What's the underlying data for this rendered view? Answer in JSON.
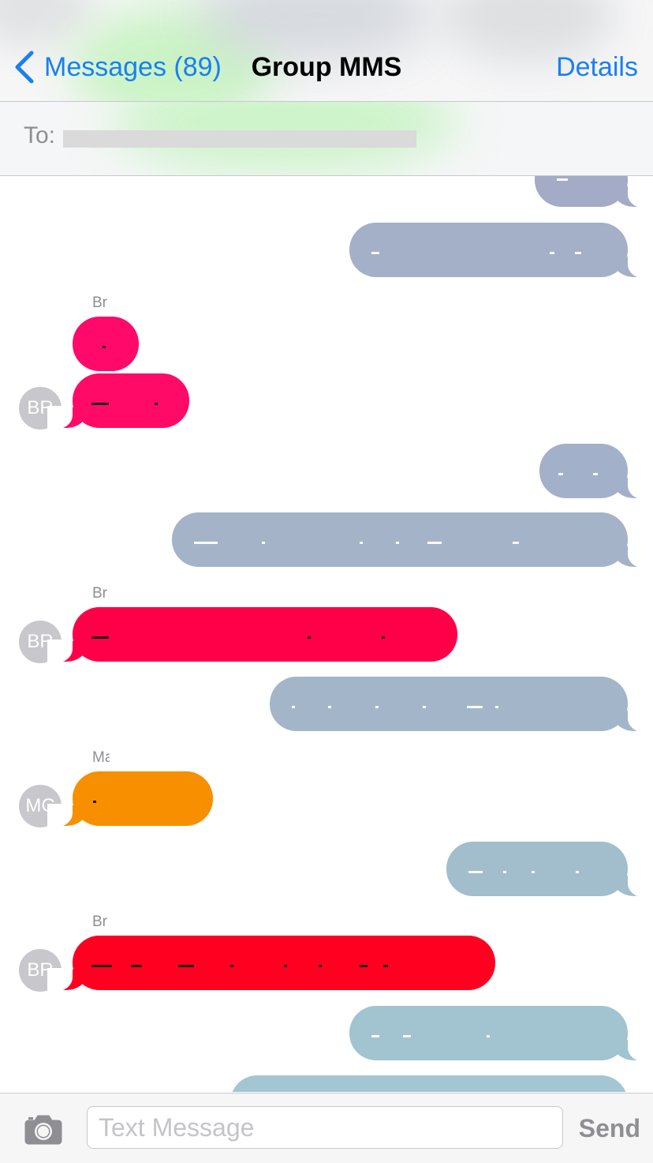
{
  "nav": {
    "back_label": "Messages (89)",
    "title": "Group MMS",
    "details_label": "Details"
  },
  "recipients": {
    "label": "To:"
  },
  "thread": {
    "senders": [
      "Br",
      "Br",
      "Ma",
      "Br"
    ],
    "avatars": [
      "BR",
      "BR",
      "MC",
      "BR"
    ]
  },
  "colors": {
    "ios_blue": "#1a7ff0",
    "sent_bubble": "#a4b0c8",
    "incoming_br": "#ff0a5c",
    "incoming_mc": "#f78f00"
  },
  "compose": {
    "placeholder": "Text Message",
    "send_label": "Send",
    "camera_icon": "camera-icon"
  }
}
